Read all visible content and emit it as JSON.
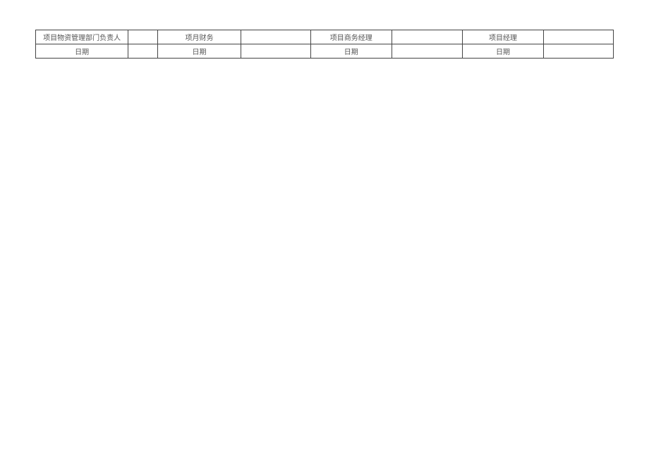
{
  "signature_table": {
    "row1": {
      "label1": "项目物资管理部门负责人",
      "value1": "",
      "label2": "项月财务",
      "value2": "",
      "label3": "项目商务经理",
      "value3": "",
      "label4": "项目经理",
      "value4": ""
    },
    "row2": {
      "label1": "日期",
      "value1": "",
      "label2": "日期",
      "value2": "",
      "label3": "日期",
      "value3": "",
      "label4": "日期",
      "value4": ""
    }
  }
}
